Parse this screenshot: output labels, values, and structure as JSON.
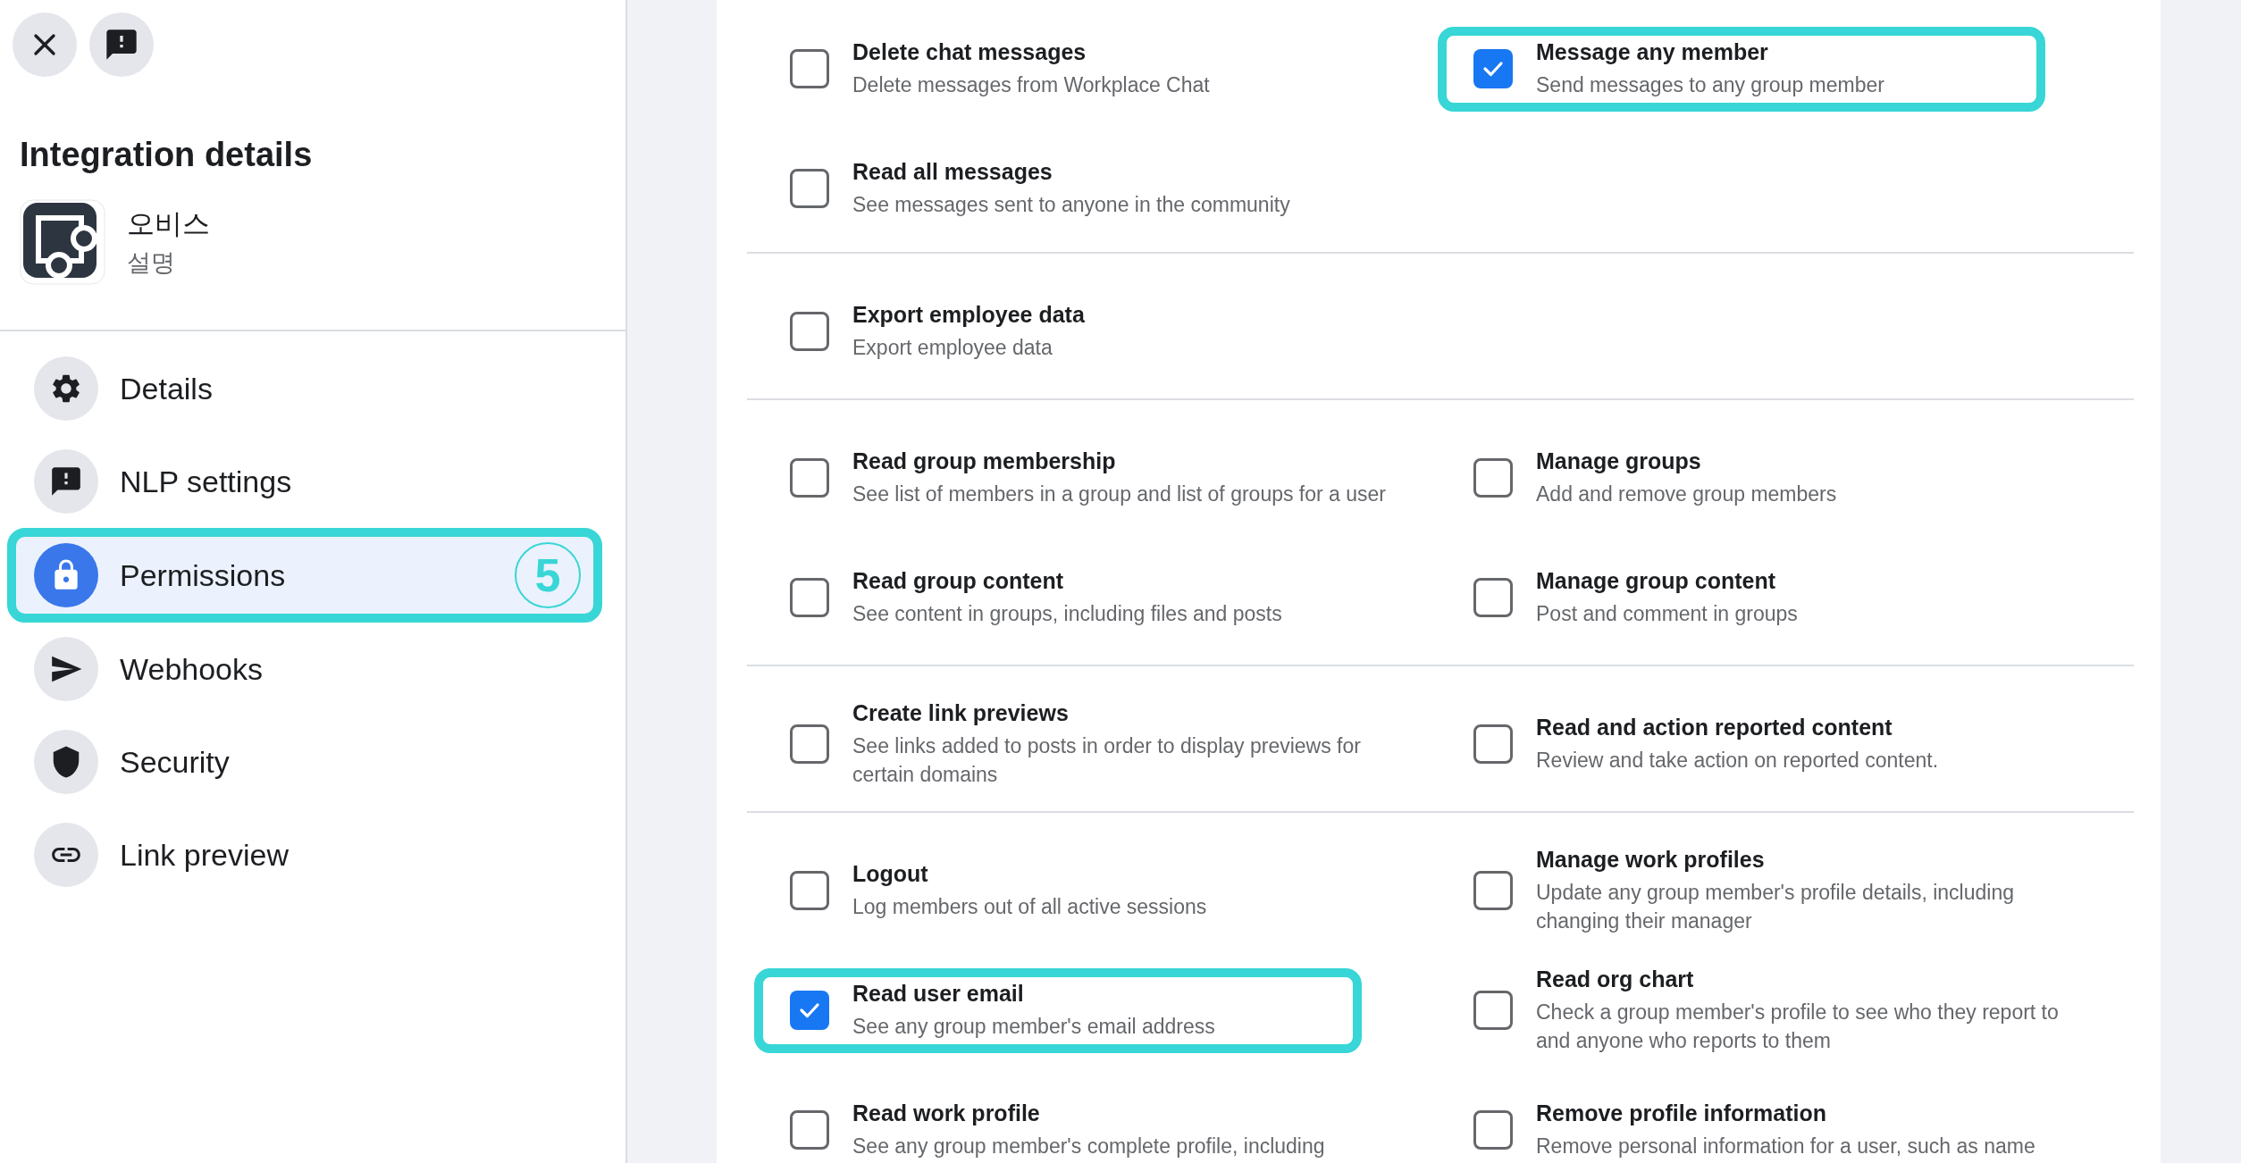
{
  "header": {
    "title": "Integration details",
    "app": {
      "name": "오비스",
      "description": "설명"
    }
  },
  "nav": [
    {
      "label": "Details",
      "selected": false,
      "highlighted": false
    },
    {
      "label": "NLP settings",
      "selected": false,
      "highlighted": false
    },
    {
      "label": "Permissions",
      "selected": true,
      "highlighted": true,
      "step": "5"
    },
    {
      "label": "Webhooks",
      "selected": false,
      "highlighted": false
    },
    {
      "label": "Security",
      "selected": false,
      "highlighted": false
    },
    {
      "label": "Link preview",
      "selected": false,
      "highlighted": false
    }
  ],
  "permission_groups": [
    {
      "rows": [
        [
          {
            "title": "Delete chat messages",
            "description": "Delete messages from Workplace Chat",
            "checked": false,
            "highlighted": false
          },
          {
            "title": "Message any member",
            "description": "Send messages to any group member",
            "checked": true,
            "highlighted": true
          }
        ],
        [
          {
            "title": "Read all messages",
            "description": "See messages sent to anyone in the community",
            "checked": false,
            "highlighted": false
          }
        ]
      ]
    },
    {
      "rows": [
        [
          {
            "title": "Export employee data",
            "description": "Export employee data",
            "checked": false,
            "highlighted": false
          }
        ]
      ]
    },
    {
      "rows": [
        [
          {
            "title": "Read group membership",
            "description": "See list of members in a group and list of groups for a user",
            "checked": false,
            "highlighted": false
          },
          {
            "title": "Manage groups",
            "description": "Add and remove group members",
            "checked": false,
            "highlighted": false
          }
        ],
        [
          {
            "title": "Read group content",
            "description": "See content in groups, including files and posts",
            "checked": false,
            "highlighted": false
          },
          {
            "title": "Manage group content",
            "description": "Post and comment in groups",
            "checked": false,
            "highlighted": false
          }
        ]
      ]
    },
    {
      "rows": [
        [
          {
            "title": "Create link previews",
            "description": "See links added to posts in order to display previews for certain domains",
            "checked": false,
            "highlighted": false
          },
          {
            "title": "Read and action reported content",
            "description": "Review and take action on reported content.",
            "checked": false,
            "highlighted": false
          }
        ]
      ]
    },
    {
      "rows": [
        [
          {
            "title": "Logout",
            "description": "Log members out of all active sessions",
            "checked": false,
            "highlighted": false
          },
          {
            "title": "Manage work profiles",
            "description": "Update any group member's profile details, including changing their manager",
            "checked": false,
            "highlighted": false
          }
        ],
        [
          {
            "title": "Read user email",
            "description": "See any group member's email address",
            "checked": true,
            "highlighted": true
          },
          {
            "title": "Read org chart",
            "description": "Check a group member's profile to see who they report to and anyone who reports to them",
            "checked": false,
            "highlighted": false
          }
        ],
        [
          {
            "title": "Read work profile",
            "description": "See any group member's complete profile, including",
            "checked": false,
            "highlighted": false
          },
          {
            "title": "Remove profile information",
            "description": "Remove personal information for a user, such as name",
            "checked": false,
            "highlighted": false
          }
        ]
      ]
    }
  ]
}
